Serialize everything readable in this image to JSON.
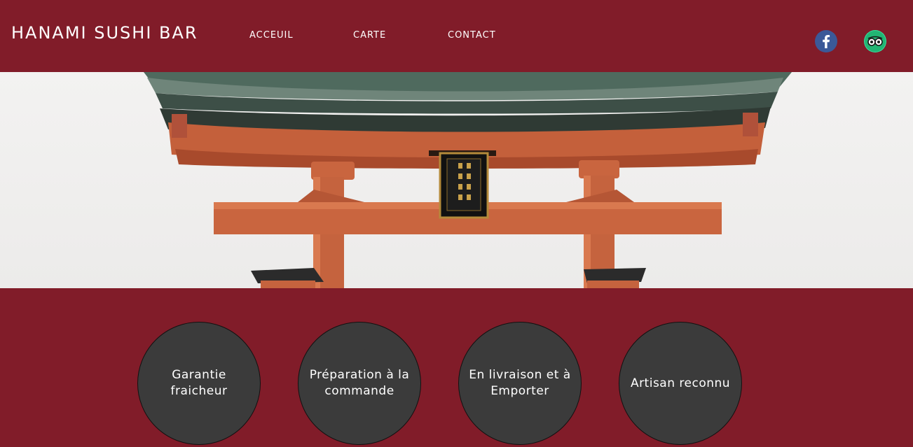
{
  "header": {
    "brand": "HANAMI SUSHI BAR",
    "nav": [
      "ACCEUIL",
      "CARTE",
      "CONTACT"
    ]
  },
  "social": {
    "facebook_icon": "facebook-icon",
    "tripadvisor_icon": "tripadvisor-icon"
  },
  "hero": {
    "image": "torii-gate-photo"
  },
  "features": [
    "Garantie fraicheur",
    "Préparation à la commande",
    "En livraison et à Emporter",
    "Artisan reconnu"
  ],
  "colors": {
    "brand_red": "#811c29",
    "circle_gray": "#3b3b3b",
    "facebook_blue": "#3b5998",
    "tripadvisor_green": "#34e0a1"
  }
}
